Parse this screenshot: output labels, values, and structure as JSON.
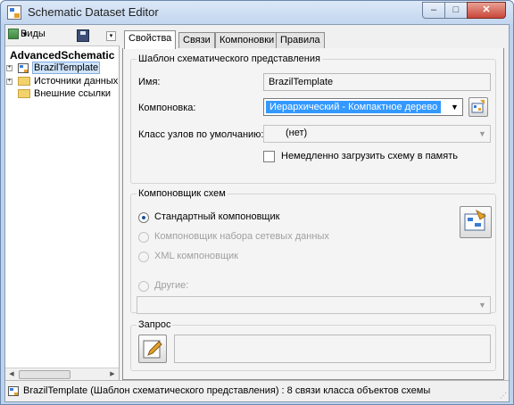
{
  "window": {
    "title": "Schematic Dataset Editor",
    "minimize": "–",
    "maximize": "□",
    "close": "✕"
  },
  "toolbar": {
    "views_label": "Виды",
    "views_arrow": "▼",
    "drop_arrow": "▾"
  },
  "tree": {
    "root": "AdvancedSchematic",
    "items": [
      {
        "label": "BrazilTemplate",
        "expander": "+",
        "icon": "template-icon",
        "selected": true
      },
      {
        "label": "Источники данных",
        "expander": "+",
        "icon": "folder-icon",
        "selected": false
      },
      {
        "label": "Внешние ссылки",
        "expander": "",
        "icon": "folder-icon",
        "selected": false
      }
    ]
  },
  "scroll": {
    "left": "◀",
    "right": "▶"
  },
  "tabs": [
    "Свойства",
    "Связи",
    "Компоновки",
    "Правила"
  ],
  "template_group": {
    "title": "Шаблон схематического представления",
    "name_label": "Имя:",
    "name_value": "BrazilTemplate",
    "layout_label": "Компоновка:",
    "layout_value": "Иерархический - Компактное дерево",
    "node_class_label": "Класс узлов по умолчанию:",
    "node_class_value": "(нет)",
    "load_checkbox_label": "Немедленно загрузить схему в память",
    "load_checked": false
  },
  "builder_group": {
    "title": "Компоновщик схем",
    "options": [
      {
        "label": "Стандартный компоновщик",
        "checked": true,
        "enabled": true
      },
      {
        "label": "Компоновщик набора сетевых данных",
        "checked": false,
        "enabled": false
      },
      {
        "label": "XML  компоновщик",
        "checked": false,
        "enabled": false
      },
      {
        "label": "Другие:",
        "checked": false,
        "enabled": false
      }
    ],
    "other_value": ""
  },
  "query_group": {
    "title": "Запрос",
    "query_value": ""
  },
  "status": {
    "text": "BrazilTemplate (Шаблон схематического представления) : 8 связи класса объектов схемы",
    "grip": "⋰"
  },
  "colors": {
    "selection": "#3399ff",
    "title_bar": "#c2d6ef",
    "close_button": "#c9463a"
  },
  "combo_arrow": "▼"
}
